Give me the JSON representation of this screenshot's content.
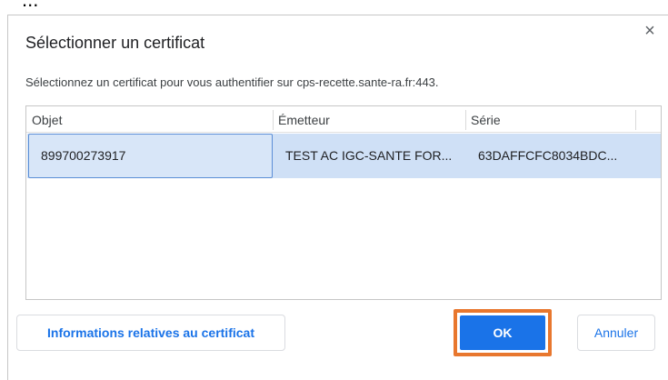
{
  "background_fragment": "...",
  "dialog": {
    "title": "Sélectionner un certificat",
    "close_icon": "×",
    "subtitle": "Sélectionnez un certificat pour vous authentifier sur cps-recette.sante-ra.fr:443."
  },
  "table": {
    "headers": [
      "Objet",
      "Émetteur",
      "Série"
    ],
    "rows": [
      {
        "objet": "899700273917",
        "emetteur": "TEST AC IGC-SANTE FOR...",
        "serie": "63DAFFCFC8034BDC...",
        "selected": true
      }
    ]
  },
  "buttons": {
    "info": "Informations relatives au certificat",
    "ok": "OK",
    "cancel": "Annuler"
  },
  "colors": {
    "accent": "#1a73e8",
    "selection": "#cfe0f6",
    "highlight": "#e8772e"
  }
}
